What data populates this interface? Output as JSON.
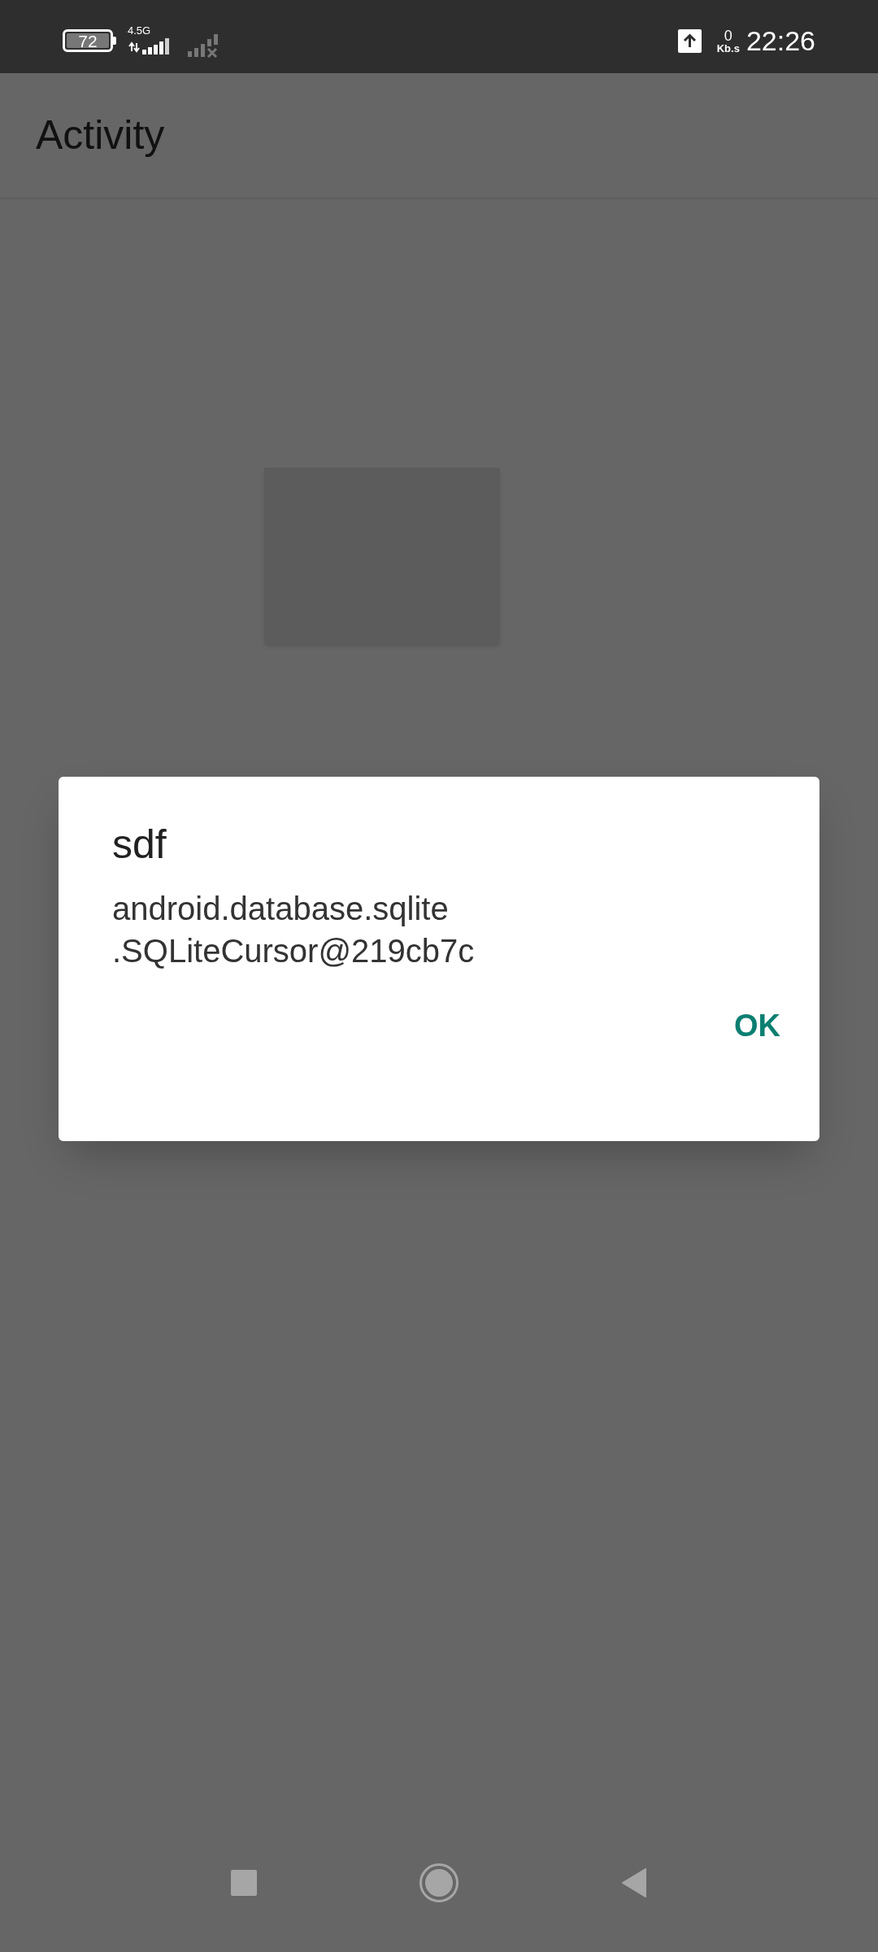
{
  "status_bar": {
    "battery": "72",
    "network": "4.5G",
    "speed_value": "0",
    "speed_unit": "Kb.s",
    "time": "22:26"
  },
  "app_bar": {
    "title": "Activity"
  },
  "dialog": {
    "title": "sdf",
    "message": "android.database.sqlite\n.SQLiteCursor@219cb7c",
    "buttons": [
      "OK"
    ]
  }
}
